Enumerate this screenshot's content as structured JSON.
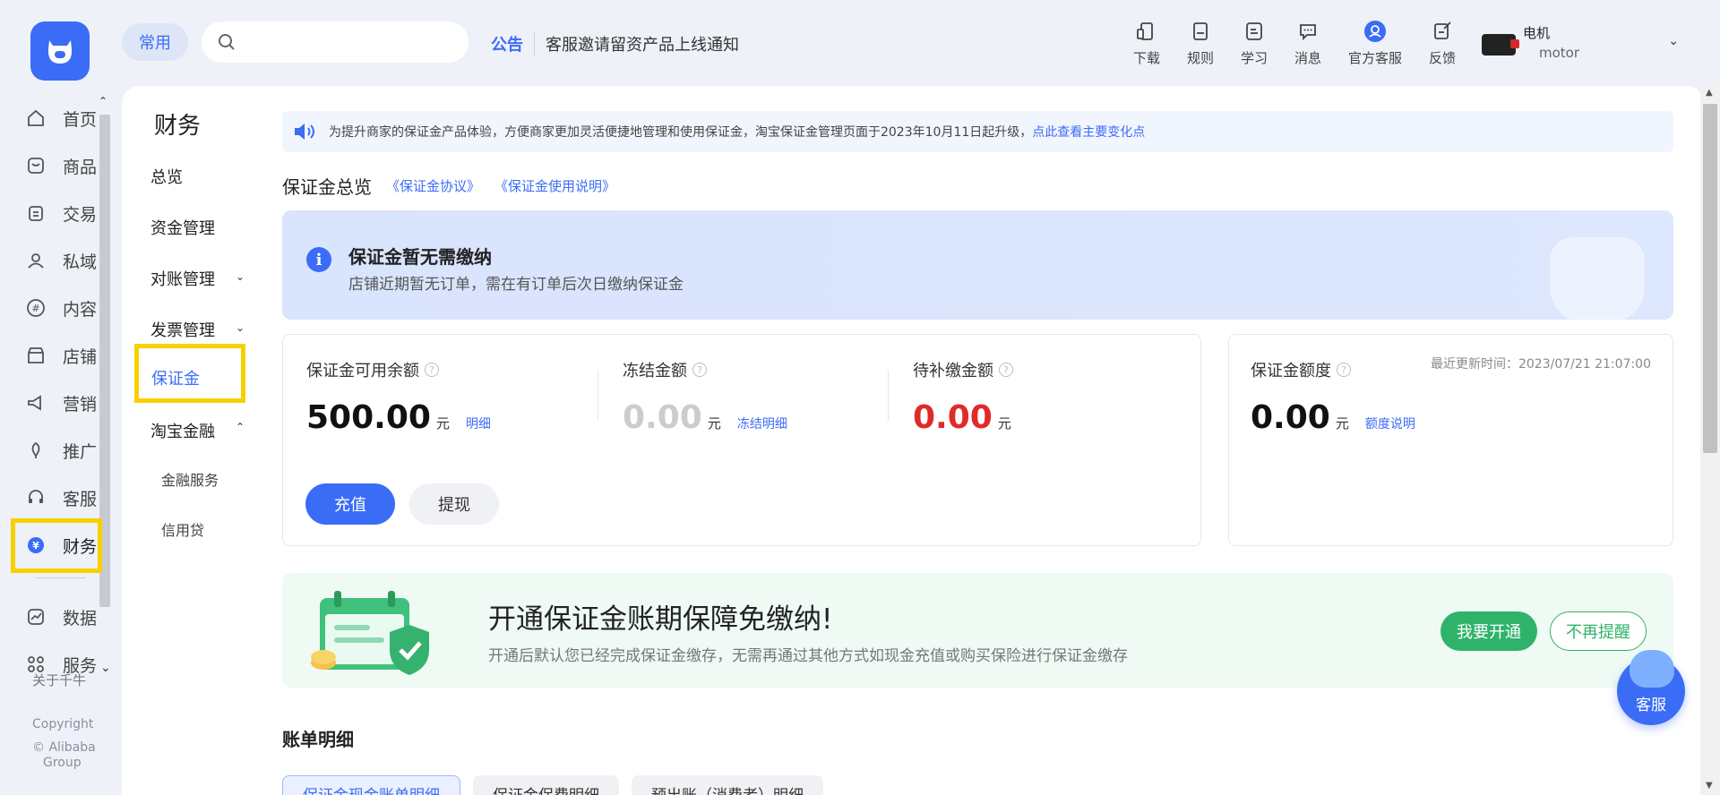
{
  "header": {
    "common_label": "常用",
    "search_placeholder": "",
    "notice_tag": "公告",
    "notice_text": "客服邀请留资产品上线通知",
    "tools": [
      {
        "label": "下载",
        "icon": "download-icon"
      },
      {
        "label": "规则",
        "icon": "rules-book-icon"
      },
      {
        "label": "学习",
        "icon": "learning-icon"
      },
      {
        "label": "消息",
        "icon": "message-icon"
      },
      {
        "label": "官方客服",
        "icon": "official-service-icon"
      },
      {
        "label": "反馈",
        "icon": "feedback-icon"
      }
    ],
    "user_name": "电机",
    "user_sub": "motor"
  },
  "nav": {
    "items": [
      {
        "label": "首页",
        "icon": "home-icon"
      },
      {
        "label": "商品",
        "icon": "product-icon"
      },
      {
        "label": "交易",
        "icon": "trade-icon"
      },
      {
        "label": "私域",
        "icon": "private-domain-icon"
      },
      {
        "label": "内容",
        "icon": "content-icon"
      },
      {
        "label": "店铺",
        "icon": "store-icon"
      },
      {
        "label": "营销",
        "icon": "marketing-icon"
      },
      {
        "label": "推广",
        "icon": "promotion-icon"
      },
      {
        "label": "客服",
        "icon": "customer-service-icon"
      },
      {
        "label": "财务",
        "icon": "finance-icon"
      },
      {
        "label": "数据",
        "icon": "data-icon"
      },
      {
        "label": "服务",
        "icon": "service-grid-icon"
      }
    ],
    "about": "关于千牛",
    "copyright_1": "Copyright",
    "copyright_2": "© Alibaba",
    "copyright_3": "Group"
  },
  "subnav": {
    "title": "财务",
    "items": [
      {
        "label": "总览"
      },
      {
        "label": "资金管理"
      },
      {
        "label": "对账管理"
      },
      {
        "label": "发票管理"
      },
      {
        "label": "保证金"
      },
      {
        "label": "淘宝金融"
      },
      {
        "label": "金融服务"
      },
      {
        "label": "信用贷"
      }
    ]
  },
  "content": {
    "info_text": "为提升商家的保证金产品体验，方便商家更加灵活便捷地管理和使用保证金，淘宝保证金管理页面于2023年10月11日起升级，",
    "info_link": "点此查看主要变化点",
    "overview_title": "保证金总览",
    "agreement_link": "《保证金协议》",
    "usage_link": "《保证金使用说明》",
    "status_title": "保证金暂无需缴纳",
    "status_desc": "店铺近期暂无订单，需在有订单后次日缴纳保证金",
    "metrics": [
      {
        "label": "保证金可用余额",
        "value": "500.00",
        "unit": "元",
        "link": "明细",
        "color": "#111111"
      },
      {
        "label": "冻结金额",
        "value": "0.00",
        "unit": "元",
        "link": "冻结明细",
        "color": "#cccccc"
      },
      {
        "label": "待补缴金额",
        "value": "0.00",
        "unit": "元",
        "link": "",
        "color": "#e02a2a"
      }
    ],
    "recharge_label": "充值",
    "withdraw_label": "提现",
    "quota_label": "保证金额度",
    "quota_value": "0.00",
    "quota_unit": "元",
    "quota_link": "额度说明",
    "update_time": "最近更新时间：2023/07/21 21:07:00",
    "promo_title": "开通保证金账期保障免缴纳!",
    "promo_desc": "开通后默认您已经完成保证金缴存，无需再通过其他方式如现金充值或购买保险进行保证金缴存",
    "promo_open": "我要开通",
    "promo_dismiss": "不再提醒",
    "float_service": "客服",
    "bill_title": "账单明细",
    "tabs": [
      {
        "label": "保证金现金账单明细"
      },
      {
        "label": "保证金保费明细"
      },
      {
        "label": "预出账（消费者）明细"
      }
    ]
  },
  "colors": {
    "accent": "#3b6cf6",
    "highlight_box": "#f8d000",
    "promo_green": "#2fb36b",
    "danger": "#e02a2a"
  }
}
